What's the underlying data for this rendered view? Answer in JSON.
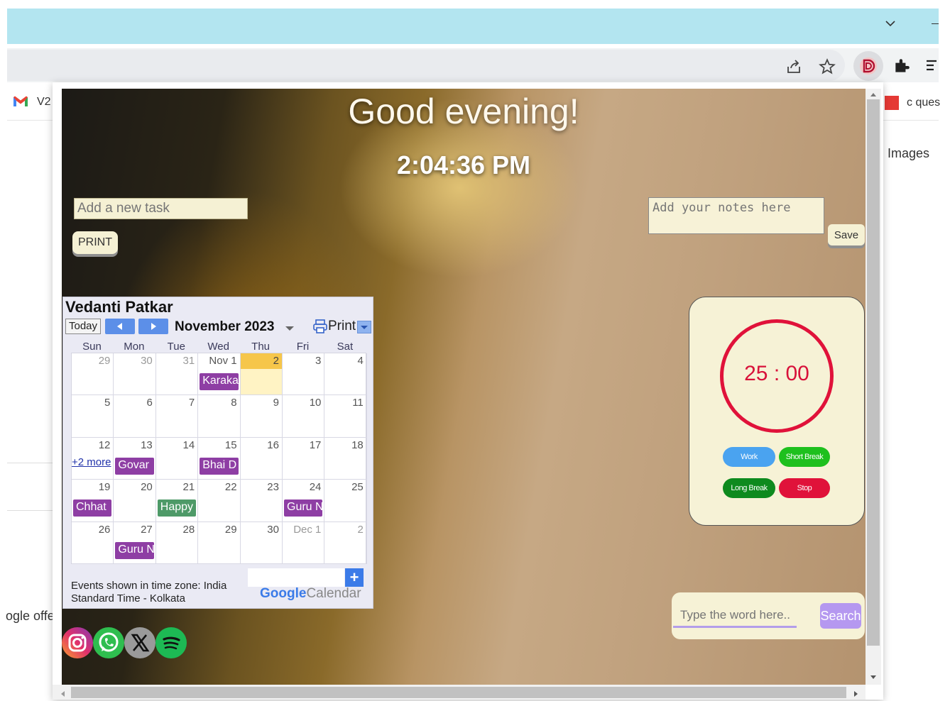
{
  "browser": {
    "bookmark_left_label": "V2",
    "bookmark_right_label": "c ques",
    "right_side_text": "Images",
    "left_side_text": "ogle offe"
  },
  "greeting": "Good evening!",
  "clock": "2:04:36 PM",
  "tasks": {
    "placeholder": "Add a new task",
    "print_label": "PRINT"
  },
  "notes": {
    "placeholder": "Add your notes here",
    "save_label": "Save"
  },
  "calendar": {
    "owner": "Vedanti Patkar",
    "today_label": "Today",
    "month_label": "November 2023",
    "print_label": "Print",
    "days_of_week": [
      "Sun",
      "Mon",
      "Tue",
      "Wed",
      "Thu",
      "Fri",
      "Sat"
    ],
    "weeks": [
      [
        "29",
        "30",
        "31",
        "Nov 1",
        "2",
        "3",
        "4"
      ],
      [
        "5",
        "6",
        "7",
        "8",
        "9",
        "10",
        "11"
      ],
      [
        "12",
        "13",
        "14",
        "15",
        "16",
        "17",
        "18"
      ],
      [
        "19",
        "20",
        "21",
        "22",
        "23",
        "24",
        "25"
      ],
      [
        "26",
        "27",
        "28",
        "29",
        "30",
        "Dec 1",
        "2"
      ]
    ],
    "more_link": "+2 more",
    "events": [
      {
        "text": "Karaka",
        "week": 0,
        "day": 3,
        "color": "#8e3ea4"
      },
      {
        "text": "Govar",
        "week": 2,
        "day": 1,
        "color": "#8e3ea4"
      },
      {
        "text": "Bhai D",
        "week": 2,
        "day": 3,
        "color": "#8e3ea4"
      },
      {
        "text": "Chhat",
        "week": 3,
        "day": 0,
        "color": "#8e3ea4"
      },
      {
        "text": "Happy",
        "week": 3,
        "day": 2,
        "color": "#4e9a68"
      },
      {
        "text": "Guru N",
        "week": 3,
        "day": 5,
        "color": "#8e3ea4"
      },
      {
        "text": "Guru N",
        "week": 4,
        "day": 1,
        "color": "#8e3ea4"
      }
    ],
    "timezone_text": "Events shown in time zone: India Standard Time - Kolkata",
    "brand_google": "Google",
    "brand_calendar": "Calendar"
  },
  "timer": {
    "display": "25 : 00",
    "buttons": [
      {
        "label": "Work",
        "color": "#4aa3f0"
      },
      {
        "label": "Short Break",
        "color": "#1ec01e"
      },
      {
        "label": "Long Break",
        "color": "#0e8a1e"
      },
      {
        "label": "Stop",
        "color": "#e0123a"
      }
    ]
  },
  "search": {
    "placeholder": "Type the word here..",
    "button_label": "Search"
  },
  "social_icons": [
    "instagram-icon",
    "whatsapp-icon",
    "x-icon",
    "spotify-icon"
  ]
}
